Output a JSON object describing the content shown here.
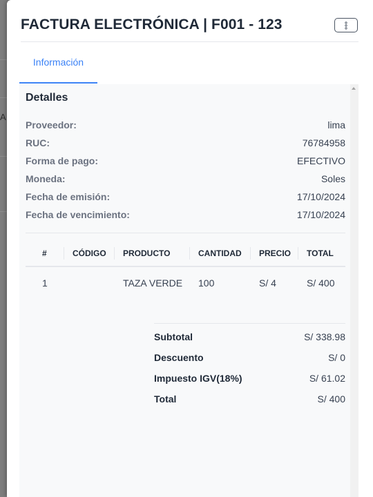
{
  "background": {
    "partial_text": "A"
  },
  "modal": {
    "title": "FACTURA ELECTRÓNICA | F001 - 123",
    "menu_icon": "kebab-vertical-icon"
  },
  "tabs": [
    {
      "label": "Información",
      "active": true
    }
  ],
  "details": {
    "title": "Detalles",
    "rows": [
      {
        "label": "Proveedor:",
        "value": "lima"
      },
      {
        "label": "RUC:",
        "value": "76784958"
      },
      {
        "label": "Forma de pago:",
        "value": "EFECTIVO"
      },
      {
        "label": "Moneda:",
        "value": "Soles"
      },
      {
        "label": "Fecha de emisión:",
        "value": "17/10/2024"
      },
      {
        "label": "Fecha de vencimiento:",
        "value": "17/10/2024"
      }
    ]
  },
  "table": {
    "headers": [
      "#",
      "CÓDIGO",
      "PRODUCTO",
      "CANTIDAD",
      "PRECIO",
      "TOTAL"
    ],
    "rows": [
      [
        "1",
        "",
        "TAZA VERDE",
        "100",
        "S/ 4",
        "S/ 400"
      ]
    ]
  },
  "totals": [
    {
      "label": "Subtotal",
      "value": "S/ 338.98"
    },
    {
      "label": "Descuento",
      "value": "S/ 0"
    },
    {
      "label": "Impuesto IGV(18%)",
      "value": "S/ 61.02"
    },
    {
      "label": "Total",
      "value": "S/ 400"
    }
  ],
  "colors": {
    "accent": "#3b82f6",
    "overlay": "#7e7e7e",
    "title_text": "#1f2937",
    "label_text": "#6b7280"
  }
}
